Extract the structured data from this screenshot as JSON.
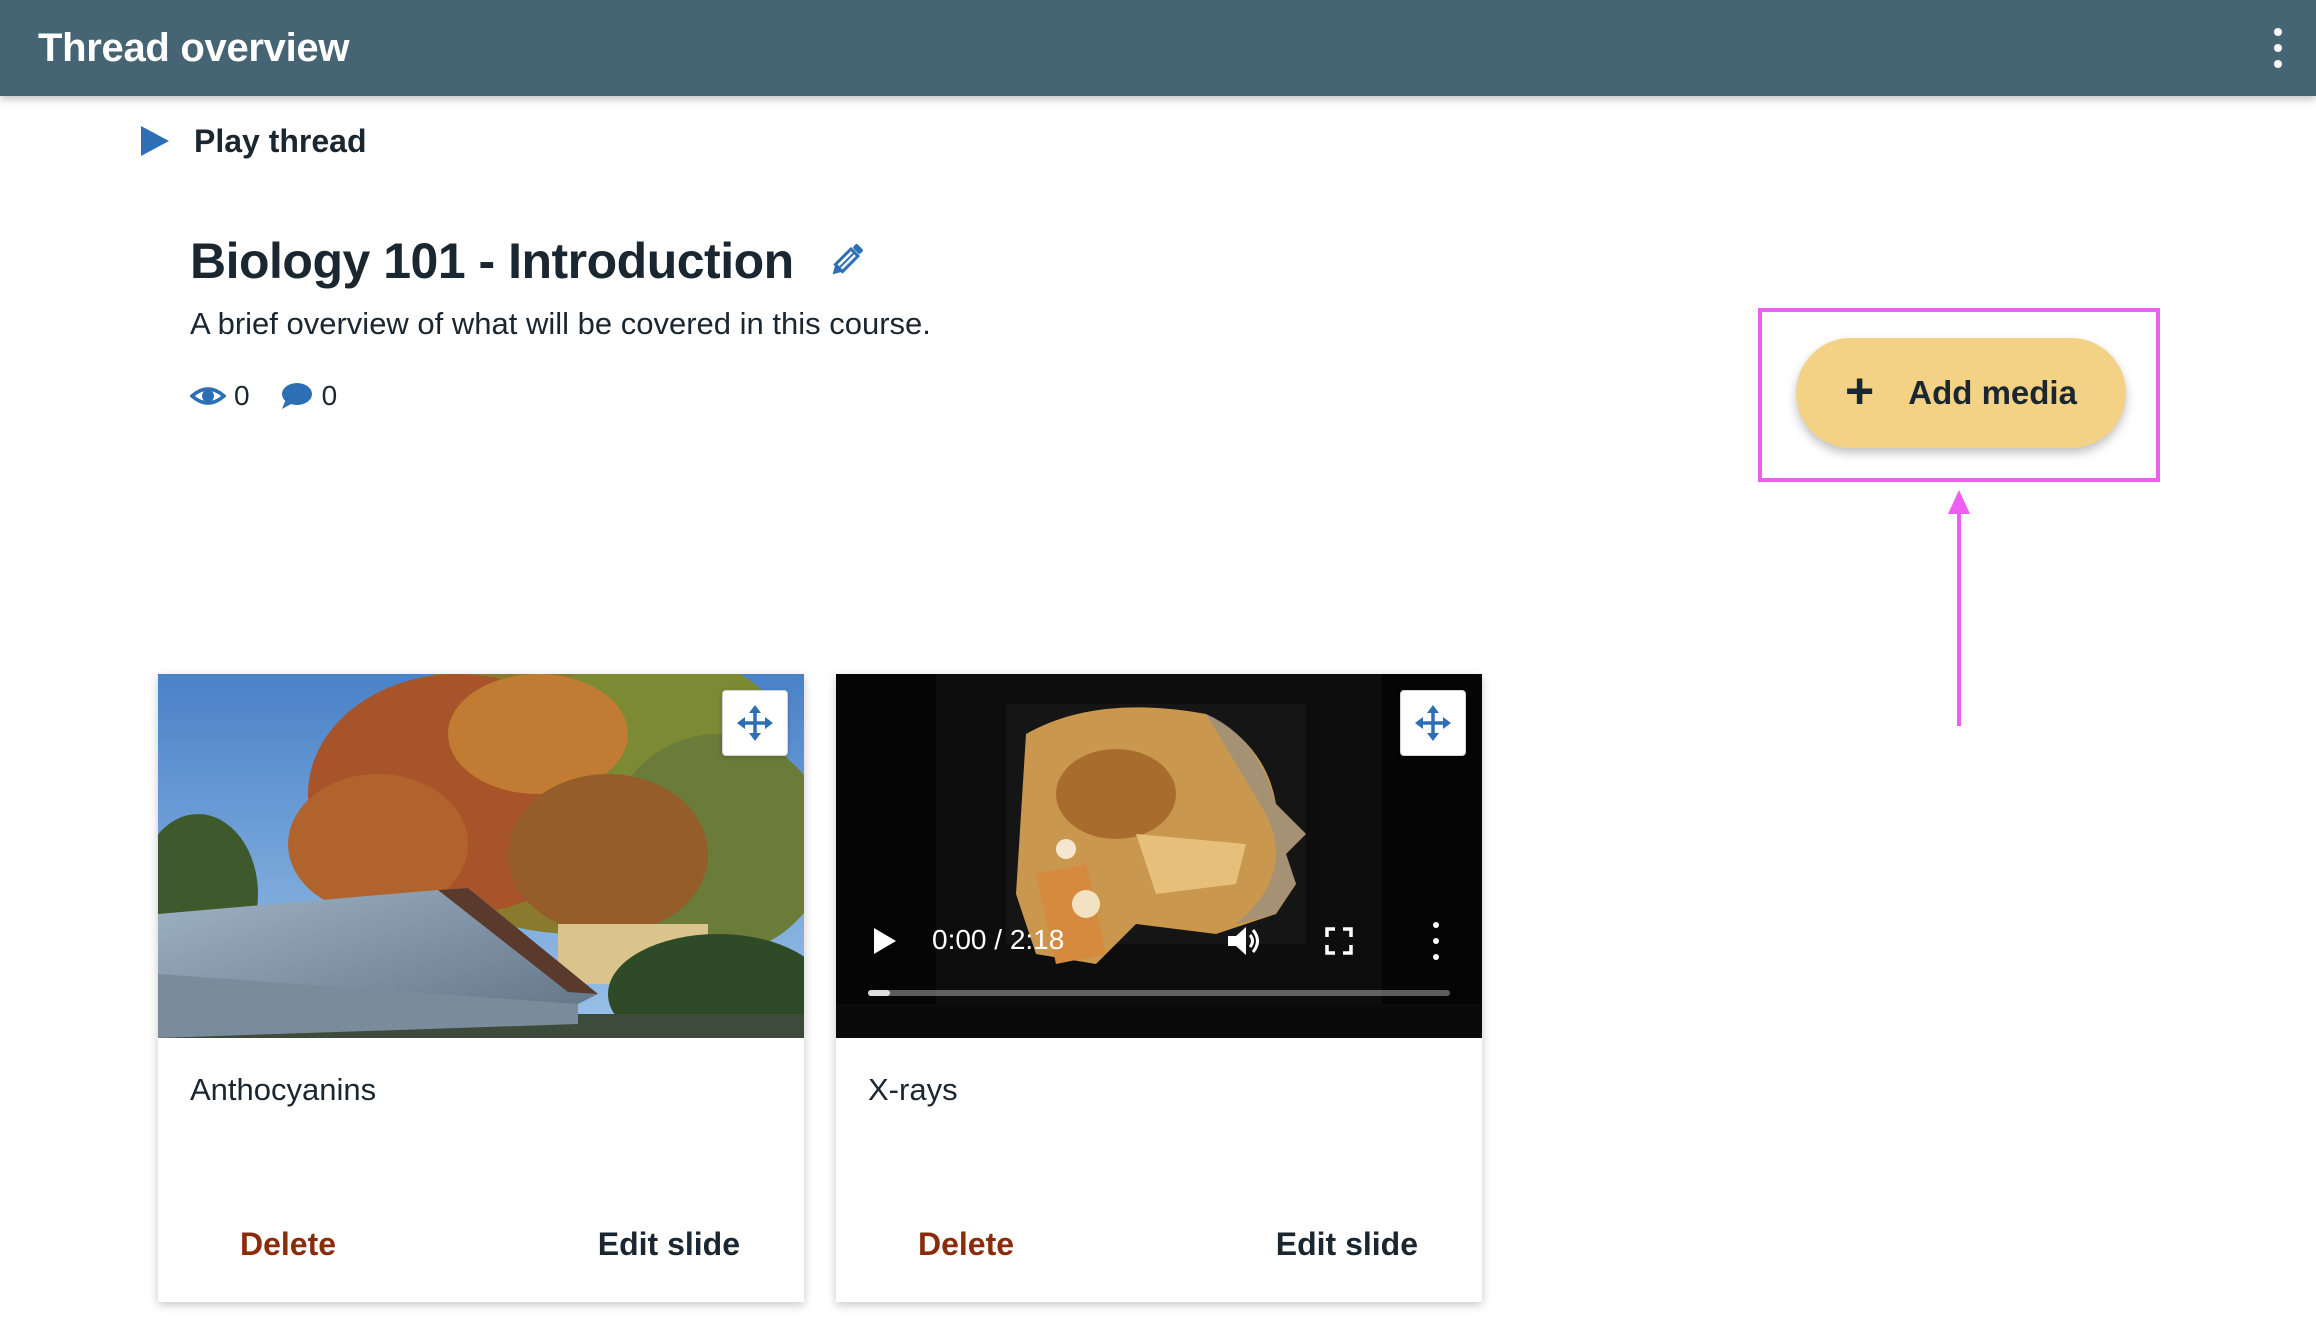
{
  "header": {
    "title": "Thread overview"
  },
  "play_thread": {
    "label": "Play thread"
  },
  "thread": {
    "title": "Biology 101 - Introduction",
    "description": "A brief overview of what will be covered in this course.",
    "views": "0",
    "comments": "0"
  },
  "add_media": {
    "label": "Add media"
  },
  "slides": [
    {
      "title": "Anthocyanins",
      "delete_label": "Delete",
      "edit_label": "Edit slide"
    },
    {
      "title": "X-rays",
      "delete_label": "Delete",
      "edit_label": "Edit slide",
      "video": {
        "time": "0:00 / 2:18",
        "progress_fraction": 0.0
      }
    }
  ],
  "colors": {
    "header": "#456574",
    "accent_blue": "#2c6fb5",
    "add_media_bg": "#f3d286",
    "highlight": "#ee5ef0",
    "delete": "#8a2b0c"
  }
}
